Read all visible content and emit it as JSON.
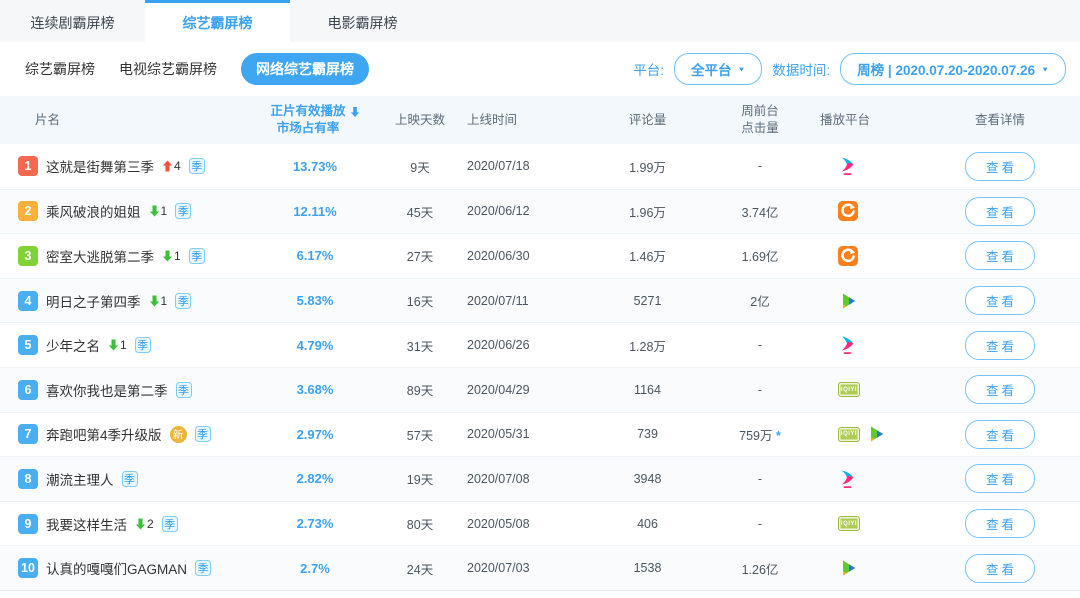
{
  "tabs": [
    {
      "label": "连续剧霸屏榜",
      "active": false
    },
    {
      "label": "综艺霸屏榜",
      "active": true
    },
    {
      "label": "电影霸屏榜",
      "active": false
    }
  ],
  "subtabs": [
    {
      "label": "综艺霸屏榜",
      "active": false
    },
    {
      "label": "电视综艺霸屏榜",
      "active": false
    },
    {
      "label": "网络综艺霸屏榜",
      "active": true
    }
  ],
  "filters": {
    "platform_label": "平台:",
    "platform_value": "全平台",
    "time_label": "数据时间:",
    "time_value": "周榜 | 2020.07.20-2020.07.26"
  },
  "colors": {
    "accent_blue": "#3ca1f0",
    "rank1": "#f4694f",
    "rank2": "#fbb03b",
    "rank3": "#7fd334",
    "rank_default": "#49aef2",
    "trend_up": "#f4503c",
    "trend_down": "#3dbf3d",
    "new_badge": "#edb438"
  },
  "table": {
    "headers": {
      "title": "片名",
      "share_line1": "正片有效播放",
      "share_line2": "市场占有率",
      "days": "上映天数",
      "online": "上线时间",
      "comments": "评论量",
      "clicks_line1": "周前台",
      "clicks_line2": "点击量",
      "platform": "播放平台",
      "detail": "查看详情"
    },
    "season_label": "季",
    "new_label": "新",
    "view_label": "查看",
    "rows": [
      {
        "rank": 1,
        "rank_color": "#f4694f",
        "title": "这就是街舞第三季",
        "trend": "up",
        "trend_value": "4",
        "is_new": false,
        "season": true,
        "share": "13.73%",
        "days": "9天",
        "online": "2020/07/18",
        "comments": "1.99万",
        "clicks": "-",
        "clicks_star": false,
        "platforms": [
          "youku"
        ]
      },
      {
        "rank": 2,
        "rank_color": "#fbb03b",
        "title": "乘风破浪的姐姐",
        "trend": "down",
        "trend_value": "1",
        "is_new": false,
        "season": true,
        "share": "12.11%",
        "days": "45天",
        "online": "2020/06/12",
        "comments": "1.96万",
        "clicks": "3.74亿",
        "clicks_star": false,
        "platforms": [
          "mgtv"
        ]
      },
      {
        "rank": 3,
        "rank_color": "#7fd334",
        "title": "密室大逃脱第二季",
        "trend": "down",
        "trend_value": "1",
        "is_new": false,
        "season": true,
        "share": "6.17%",
        "days": "27天",
        "online": "2020/06/30",
        "comments": "1.46万",
        "clicks": "1.69亿",
        "clicks_star": false,
        "platforms": [
          "mgtv"
        ]
      },
      {
        "rank": 4,
        "rank_color": "#49aef2",
        "title": "明日之子第四季",
        "trend": "down",
        "trend_value": "1",
        "is_new": false,
        "season": true,
        "share": "5.83%",
        "days": "16天",
        "online": "2020/07/11",
        "comments": "5271",
        "clicks": "2亿",
        "clicks_star": false,
        "platforms": [
          "tencent"
        ]
      },
      {
        "rank": 5,
        "rank_color": "#49aef2",
        "title": "少年之名",
        "trend": "down",
        "trend_value": "1",
        "is_new": false,
        "season": true,
        "share": "4.79%",
        "days": "31天",
        "online": "2020/06/26",
        "comments": "1.28万",
        "clicks": "-",
        "clicks_star": false,
        "platforms": [
          "youku"
        ]
      },
      {
        "rank": 6,
        "rank_color": "#49aef2",
        "title": "喜欢你我也是第二季",
        "trend": "none",
        "trend_value": "",
        "is_new": false,
        "season": true,
        "share": "3.68%",
        "days": "89天",
        "online": "2020/04/29",
        "comments": "1164",
        "clicks": "-",
        "clicks_star": false,
        "platforms": [
          "iqiyi"
        ]
      },
      {
        "rank": 7,
        "rank_color": "#49aef2",
        "title": "奔跑吧第4季升级版",
        "trend": "none",
        "trend_value": "",
        "is_new": true,
        "season": true,
        "share": "2.97%",
        "days": "57天",
        "online": "2020/05/31",
        "comments": "739",
        "clicks": "759万",
        "clicks_star": true,
        "platforms": [
          "iqiyi",
          "tencent"
        ]
      },
      {
        "rank": 8,
        "rank_color": "#49aef2",
        "title": "潮流主理人",
        "trend": "none",
        "trend_value": "",
        "is_new": false,
        "season": true,
        "share": "2.82%",
        "days": "19天",
        "online": "2020/07/08",
        "comments": "3948",
        "clicks": "-",
        "clicks_star": false,
        "platforms": [
          "youku"
        ]
      },
      {
        "rank": 9,
        "rank_color": "#49aef2",
        "title": "我要这样生活",
        "trend": "down",
        "trend_value": "2",
        "is_new": false,
        "season": true,
        "share": "2.73%",
        "days": "80天",
        "online": "2020/05/08",
        "comments": "406",
        "clicks": "-",
        "clicks_star": false,
        "platforms": [
          "iqiyi"
        ]
      },
      {
        "rank": 10,
        "rank_color": "#49aef2",
        "title": "认真的嘎嘎们GAGMAN",
        "trend": "none",
        "trend_value": "",
        "is_new": false,
        "season": true,
        "share": "2.7%",
        "days": "24天",
        "online": "2020/07/03",
        "comments": "1538",
        "clicks": "1.26亿",
        "clicks_star": false,
        "platforms": [
          "tencent"
        ]
      }
    ]
  },
  "platform_icon_names": {
    "youku": "youku-icon",
    "mgtv": "mgtv-icon",
    "tencent": "tencent-video-icon",
    "iqiyi": "iqiyi-icon"
  }
}
